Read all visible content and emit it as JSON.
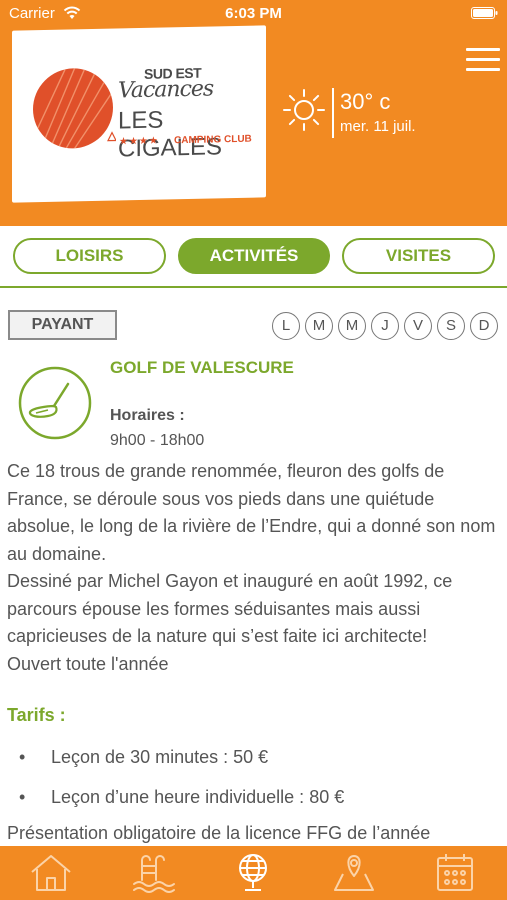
{
  "status_bar": {
    "carrier": "Carrier",
    "time": "6:03 PM"
  },
  "header": {
    "logo": {
      "brand_top": "SUD EST",
      "brand_script": "Vacances",
      "site_name": "LES CIGALES",
      "stars": "★★★★",
      "subtitle": "CAMPING CLUB"
    },
    "weather": {
      "icon": "sun-icon",
      "temperature": "30° c",
      "date": "mer. 11 juil."
    },
    "menu_icon": "hamburger-icon"
  },
  "tabs": [
    {
      "label": "LOISIRS",
      "active": false
    },
    {
      "label": "ACTIVITÉS",
      "active": true
    },
    {
      "label": "VISITES",
      "active": false
    }
  ],
  "activity": {
    "badge": "PAYANT",
    "days": [
      "L",
      "M",
      "M",
      "J",
      "V",
      "S",
      "D"
    ],
    "icon": "golf-icon",
    "title": "GOLF DE VALESCURE",
    "hours_label": "Horaires :",
    "hours_value": "9h00 - 18h00",
    "description": "Ce 18 trous de grande renommée, fleuron des golfs de France, se déroule sous vos pieds dans une quiétude absolue, le long de la rivière de l’Endre, qui a donné son nom au domaine.\nDessiné par Michel Gayon et inauguré en août 1992, ce parcours épouse les formes séduisantes mais aussi capricieuses de la nature qui s’est faite ici architecte!\nOuvert toute l'année",
    "tarifs_label": "Tarifs :",
    "tarifs": [
      "Leçon de 30 minutes : 50 €",
      "Leçon d’une heure individuelle : 80 €"
    ],
    "footer_note": "Présentation obligatoire de la licence FFG de l’année"
  },
  "bottom_nav": [
    "home-icon",
    "pool-icon",
    "globe-icon",
    "map-icon",
    "calendar-icon"
  ],
  "colors": {
    "orange": "#f28a22",
    "green": "#7ca82c",
    "text": "#555555",
    "logo_red": "#e0502a"
  }
}
